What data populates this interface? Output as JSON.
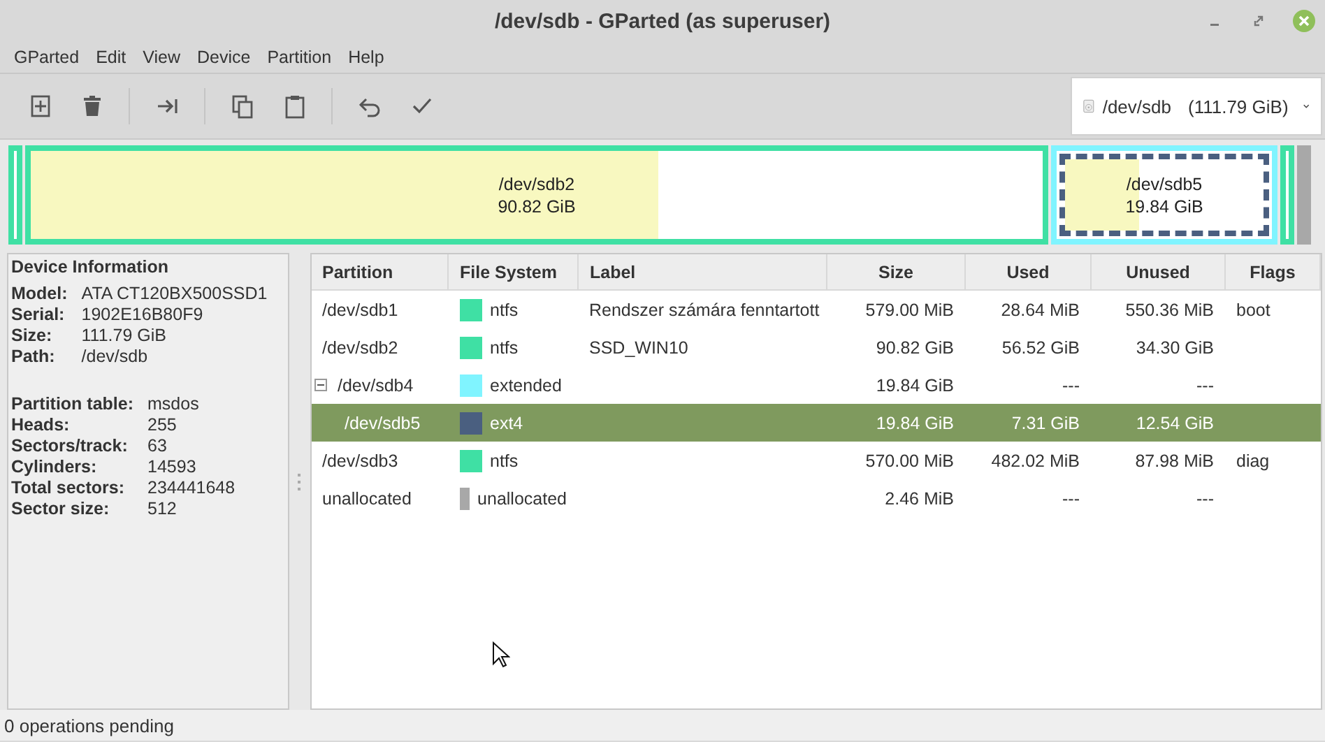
{
  "window": {
    "title": "/dev/sdb - GParted (as superuser)"
  },
  "menu": [
    "GParted",
    "Edit",
    "View",
    "Device",
    "Partition",
    "Help"
  ],
  "toolbar": [
    {
      "kind": "new",
      "disabled": false
    },
    {
      "kind": "delete",
      "disabled": false
    },
    {
      "kind": "sep"
    },
    {
      "kind": "resize",
      "disabled": false
    },
    {
      "kind": "sep"
    },
    {
      "kind": "copy",
      "disabled": false
    },
    {
      "kind": "paste",
      "disabled": false
    },
    {
      "kind": "sep"
    },
    {
      "kind": "undo",
      "disabled": false
    },
    {
      "kind": "apply",
      "disabled": false
    }
  ],
  "device_selector": {
    "value": "/dev/sdb",
    "size": "(111.79 GiB)"
  },
  "disk_map": [
    {
      "kind": "partition",
      "color": "#3fe0a4"
    },
    {
      "kind": "partition",
      "color": "#3fe0a4",
      "level": 0.62,
      "name": "/dev/sdb2",
      "size": "90.82 GiB"
    },
    {
      "kind": "extended",
      "color": "#80f4ff",
      "children": [
        {
          "kind": "partition",
          "color": "#4a5f80",
          "level": 0.37,
          "selected": true,
          "name": "/dev/sdb5",
          "size": "19.84 GiB"
        }
      ]
    },
    {
      "kind": "partition",
      "color": "#3fe0a4"
    },
    {
      "kind": "unallocated",
      "color": "#a8a8a8"
    }
  ],
  "device_info": {
    "heading": "Device Information",
    "groups": [
      [
        {
          "label": "Model:",
          "value": "ATA CT120BX500SSD1"
        },
        {
          "label": "Serial:",
          "value": "1902E16B80F9"
        },
        {
          "label": "Size:",
          "value": "111.79 GiB"
        },
        {
          "label": "Path:",
          "value": "/dev/sdb"
        }
      ],
      [
        {
          "label": "Partition table:",
          "value": "msdos"
        },
        {
          "label": "Heads:",
          "value": "255"
        },
        {
          "label": "Sectors/track:",
          "value": "63"
        },
        {
          "label": "Cylinders:",
          "value": "14593"
        },
        {
          "label": "Total sectors:",
          "value": "234441648"
        },
        {
          "label": "Sector size:",
          "value": "512"
        }
      ]
    ]
  },
  "table": {
    "columns": [
      "Partition",
      "File System",
      "Label",
      "Size",
      "Used",
      "Unused",
      "Flags"
    ],
    "rows": [
      {
        "partition": "/dev/sdb1",
        "file_system": "ntfs",
        "color": "#3fe0a4",
        "label": "Rendszer számára fenntartott",
        "size": "579.00 MiB",
        "used": "28.64 MiB",
        "unused": "550.36 MiB",
        "flags": "boot",
        "selected": false
      },
      {
        "partition": "/dev/sdb2",
        "file_system": "ntfs",
        "color": "#3fe0a4",
        "label": "SSD_WIN10",
        "size": "90.82 GiB",
        "used": "56.52 GiB",
        "unused": "34.30 GiB",
        "selected": false
      },
      {
        "partition": "/dev/sdb4",
        "file_system": "extended",
        "color": "#80f4ff",
        "size": "19.84 GiB",
        "used": "---",
        "unused": "---",
        "selected": false,
        "expanded": true,
        "children": [
          {
            "partition": "/dev/sdb5",
            "file_system": "ext4",
            "color": "#4a5f80",
            "size": "19.84 GiB",
            "used": "7.31 GiB",
            "unused": "12.54 GiB",
            "selected": true
          }
        ]
      },
      {
        "partition": "/dev/sdb3",
        "file_system": "ntfs",
        "color": "#3fe0a4",
        "size": "570.00 MiB",
        "used": "482.02 MiB",
        "unused": "87.98 MiB",
        "flags": "diag",
        "selected": false
      },
      {
        "partition": "unallocated",
        "file_system": "unallocated",
        "color": "#a8a8a8",
        "size": "2.46 MiB",
        "used": "---",
        "unused": "---",
        "selected": false
      }
    ]
  },
  "status_bar": "0 operations pending"
}
